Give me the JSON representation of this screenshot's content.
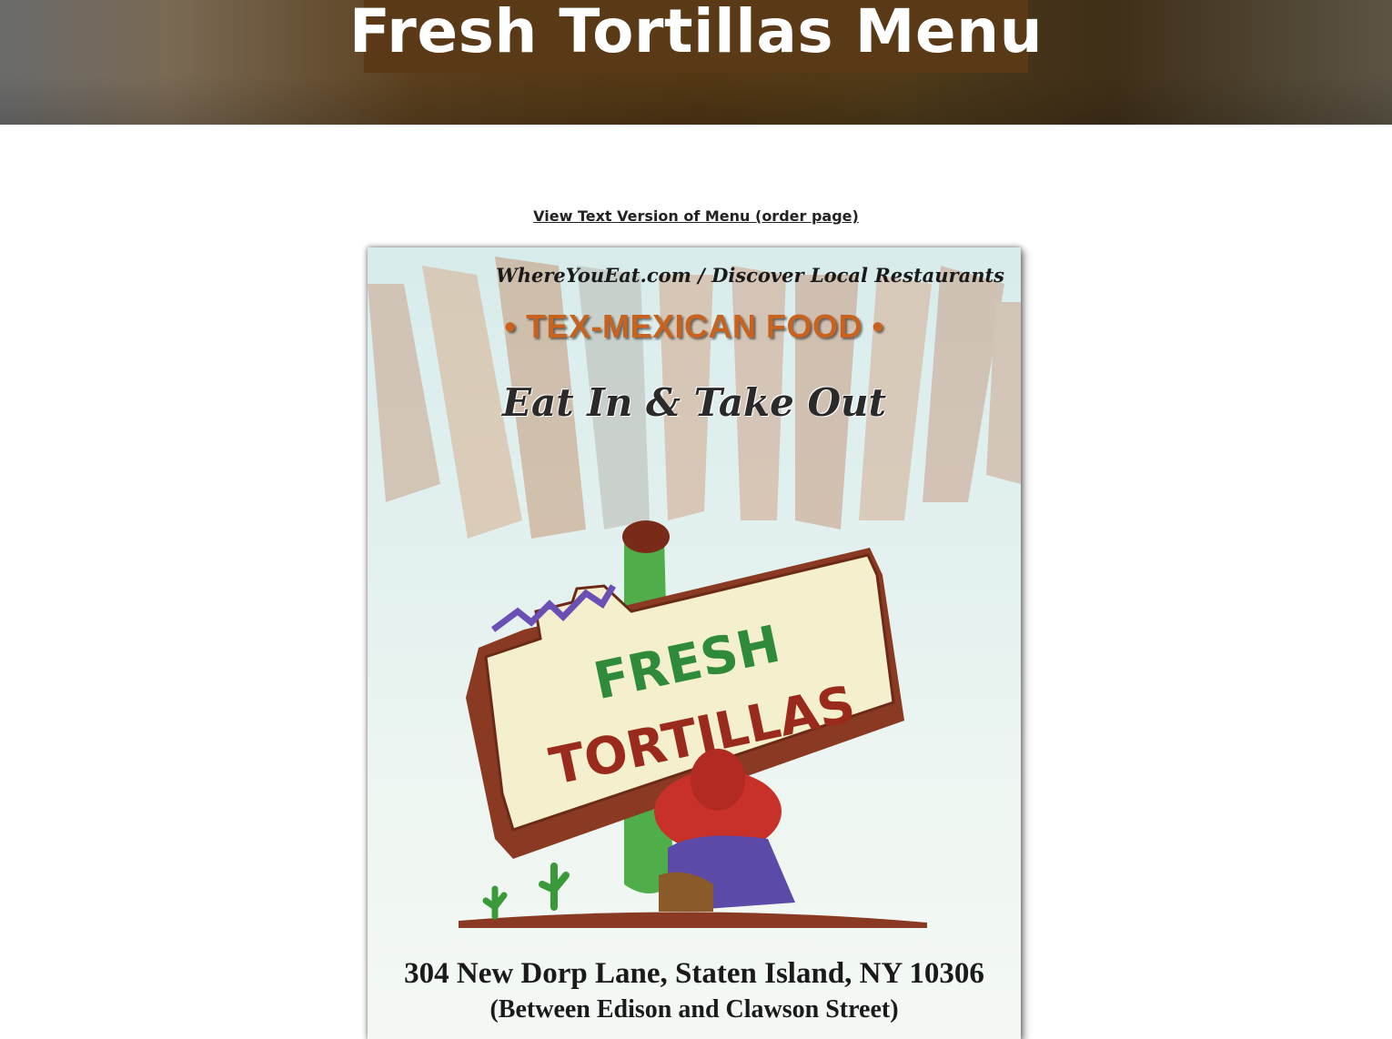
{
  "header": {
    "title": "Fresh Tortillas Menu"
  },
  "main": {
    "text_menu_link": "View Text Version of Menu (order page)"
  },
  "menu_image": {
    "site_line": "WhereYouEat.com / Discover Local Restaurants",
    "cuisine": "• TEX-MEXICAN FOOD •",
    "service": "Eat In & Take Out",
    "logo_line1": "FRESH",
    "logo_line2": "TORTILLAS",
    "address": "304 New Dorp Lane, Staten Island, NY 10306",
    "cross_streets": "(Between Edison and Clawson Street)"
  },
  "colors": {
    "title_box": "#5a3a16",
    "logo_green": "#2f8a3a",
    "logo_red": "#9a2a1c",
    "cuisine_orange": "#c8621f"
  }
}
